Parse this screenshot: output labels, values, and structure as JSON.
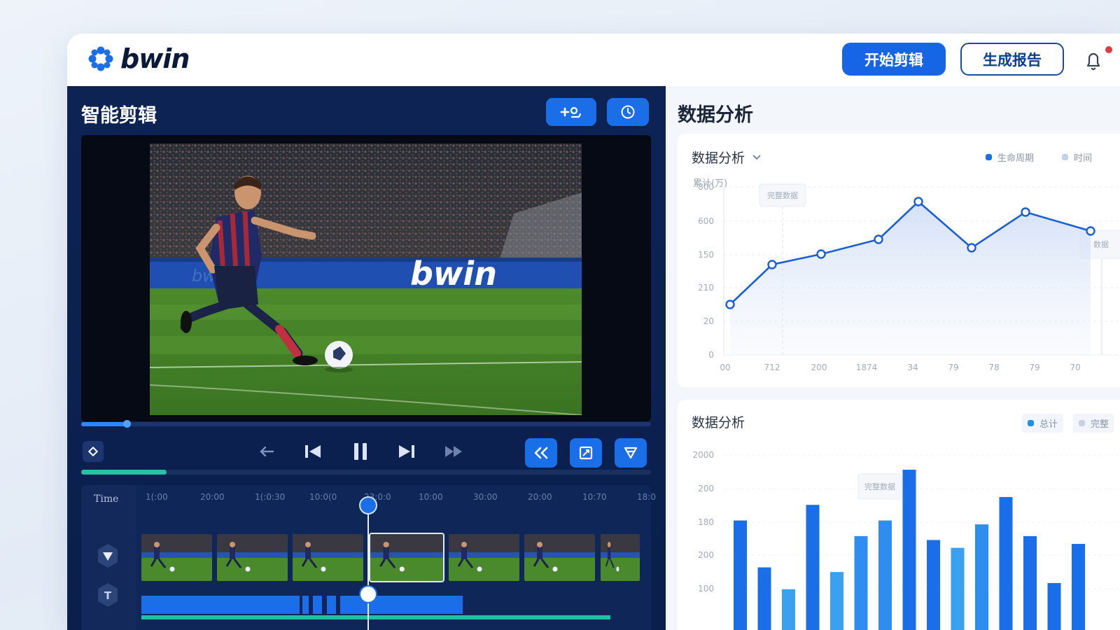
{
  "brand": {
    "name": "bwin"
  },
  "header": {
    "primary_action": "开始剪辑",
    "secondary_action": "生成报告",
    "notification_icon": "bell-icon",
    "colors": {
      "primary": "#1565e6",
      "alert": "#e23a3a"
    }
  },
  "editor": {
    "title": "智能剪辑",
    "toolbar": [
      "add-clip-icon",
      "settings-icon"
    ],
    "video": {
      "banner_text": "bwin",
      "progress": 0.08
    },
    "controls": [
      "keyframe-icon",
      "back-arrow-icon",
      "skip-back-icon",
      "pause-icon",
      "skip-forward-icon",
      "fast-forward-icon",
      "rewind-icon",
      "crop-icon",
      "filter-icon"
    ],
    "secondary_progress": 0.15,
    "timeline": {
      "label": "Time",
      "ticks": [
        "1(:00",
        "20:00",
        "1(:0:30",
        "10:0(0",
        "23:0:0",
        "10:00",
        "30:00",
        "20:00",
        "10:70",
        "18:0"
      ],
      "thumbnail_count": 7,
      "selected_thumbnail": 3,
      "tools": [
        "pointer-icon",
        "text-icon"
      ]
    }
  },
  "analytics": {
    "title": "数据分析",
    "line_card": {
      "title": "数据分析",
      "legend": [
        "生命周期",
        "时间"
      ],
      "unit": "累计(万)",
      "tooltip_left": "完整数据",
      "tooltip_right": "数据"
    },
    "bar_card": {
      "title": "数据分析",
      "legend": [
        "总计",
        "完整"
      ],
      "tooltip": "完整数据"
    }
  },
  "chart_data": [
    {
      "type": "line",
      "title": "数据分析",
      "x": [
        "00",
        "712",
        "200",
        "1874",
        "34",
        "79",
        "78",
        "79",
        "70"
      ],
      "y_ticks": [
        "0",
        "20",
        "210",
        "150",
        "600",
        "800"
      ],
      "series": [
        {
          "values": [
            120,
            215,
            240,
            275,
            365,
            255,
            340,
            295
          ]
        }
      ],
      "grid": true,
      "legend_position": "top-right"
    },
    {
      "type": "bar",
      "title": "数据分析",
      "y_ticks": [
        "100",
        "200",
        "180",
        "200",
        "2000"
      ],
      "values": [
        150,
        90,
        62,
        170,
        84,
        130,
        150,
        215,
        125,
        115,
        145,
        180,
        130,
        70,
        120
      ],
      "legend_position": "top-right"
    }
  ]
}
